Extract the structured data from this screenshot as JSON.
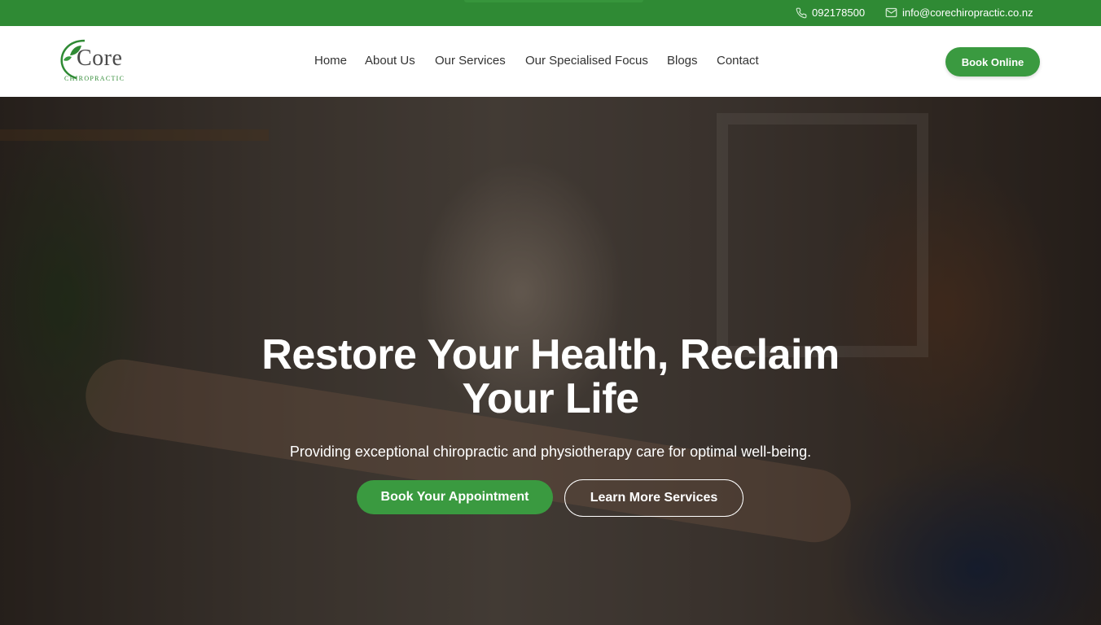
{
  "topbar": {
    "phone": "092178500",
    "email": "info@corechiropractic.co.nz",
    "phone_icon": "phone-icon",
    "email_icon": "envelope-icon"
  },
  "logo": {
    "word": "Core",
    "sub": "CHIROPRACTIC"
  },
  "nav": {
    "items": [
      {
        "label": "Home"
      },
      {
        "label": "About Us"
      },
      {
        "label": "Our Services"
      },
      {
        "label": "Our Specialised Focus"
      },
      {
        "label": "Blogs"
      },
      {
        "label": "Contact"
      }
    ]
  },
  "header": {
    "cta_label": "Book Online"
  },
  "hero": {
    "title": "Restore Your Health, Reclaim Your Life",
    "subtitle": "Providing exceptional chiropractic and physiotherapy care for optimal well-being.",
    "primary_button": "Book Your Appointment",
    "secondary_button": "Learn More Services"
  },
  "colors": {
    "brand_green": "#2f8a34",
    "button_green": "#3a9a40",
    "nav_text": "#333333"
  }
}
